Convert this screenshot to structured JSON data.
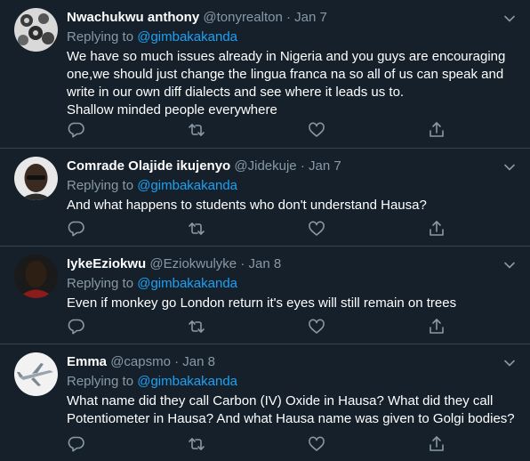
{
  "tweets": [
    {
      "name": "Nwachukwu anthony",
      "handle": "@tonyrealton",
      "separator": "·",
      "date": "Jan 7",
      "replying_prefix": "Replying to",
      "replying_to": "@gimbakakanda",
      "text": "We have so much issues already in Nigeria and you guys are encouraging\none,we should just change the lingua franca na so all of us can speak and\nwrite in our own diff dialects and see where it leads us to.\nShallow minded people everywhere"
    },
    {
      "name": "Comrade Olajide ikujenyo",
      "handle": "@Jidekuje",
      "separator": "·",
      "date": "Jan 7",
      "replying_prefix": "Replying to",
      "replying_to": "@gimbakakanda",
      "text": "And what happens to students who don't understand Hausa?"
    },
    {
      "name": "IykeEziokwu",
      "handle": "@Eziokwulyke",
      "separator": "·",
      "date": "Jan 8",
      "replying_prefix": "Replying to",
      "replying_to": "@gimbakakanda",
      "text": "Even if monkey go London return it's eyes will still remain on trees"
    },
    {
      "name": "Emma",
      "handle": "@capsmo",
      "separator": "·",
      "date": "Jan 8",
      "replying_prefix": "Replying to",
      "replying_to": "@gimbakakanda",
      "text": "What name did they call Carbon (IV) Oxide in Hausa? What did they call\nPotentiometer in Hausa? And what Hausa name was given to Golgi bodies?"
    }
  ],
  "icons": {
    "reply": "reply-icon",
    "retweet": "retweet-icon",
    "like": "heart-icon",
    "share": "share-icon",
    "more": "chevron-down-icon"
  },
  "colors": {
    "background": "#15202b",
    "border": "#38444d",
    "secondary_text": "#8899a6",
    "link": "#1da1f2"
  }
}
